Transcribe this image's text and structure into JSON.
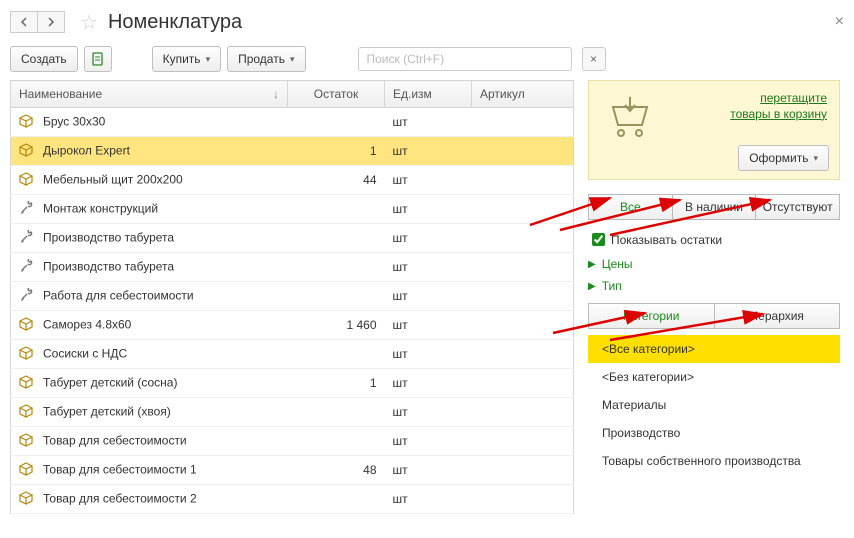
{
  "header": {
    "title": "Номенклатура"
  },
  "toolbar": {
    "create": "Создать",
    "buy": "Купить",
    "sell": "Продать",
    "search_placeholder": "Поиск (Ctrl+F)"
  },
  "table": {
    "columns": {
      "name": "Наименование",
      "stock": "Остаток",
      "unit": "Ед.изм",
      "sku": "Артикул"
    },
    "rows": [
      {
        "icon": "box",
        "name": "Брус 30х30",
        "stock": "",
        "unit": "шт",
        "sku": ""
      },
      {
        "icon": "box",
        "name": "Дырокол Expert",
        "stock": "1",
        "unit": "шт",
        "sku": "",
        "selected": true
      },
      {
        "icon": "box",
        "name": "Мебельный щит 200х200",
        "stock": "44",
        "unit": "шт",
        "sku": ""
      },
      {
        "icon": "tool",
        "name": "Монтаж конструкций",
        "stock": "",
        "unit": "шт",
        "sku": ""
      },
      {
        "icon": "tool",
        "name": "Производство табурета",
        "stock": "",
        "unit": "шт",
        "sku": ""
      },
      {
        "icon": "tool",
        "name": "Производство табурета",
        "stock": "",
        "unit": "шт",
        "sku": ""
      },
      {
        "icon": "tool",
        "name": "Работа для себестоимости",
        "stock": "",
        "unit": "шт",
        "sku": ""
      },
      {
        "icon": "box",
        "name": "Саморез 4.8х60",
        "stock": "1 460",
        "unit": "шт",
        "sku": ""
      },
      {
        "icon": "box",
        "name": "Сосиски с НДС",
        "stock": "",
        "unit": "шт",
        "sku": ""
      },
      {
        "icon": "box",
        "name": "Табурет детский (сосна)",
        "stock": "1",
        "unit": "шт",
        "sku": ""
      },
      {
        "icon": "box",
        "name": "Табурет детский (хвоя)",
        "stock": "",
        "unit": "шт",
        "sku": ""
      },
      {
        "icon": "box",
        "name": "Товар для себестоимости",
        "stock": "",
        "unit": "шт",
        "sku": ""
      },
      {
        "icon": "box",
        "name": "Товар для себестоимости 1",
        "stock": "48",
        "unit": "шт",
        "sku": ""
      },
      {
        "icon": "box",
        "name": "Товар для себестоимости 2",
        "stock": "",
        "unit": "шт",
        "sku": ""
      }
    ]
  },
  "cart": {
    "link_line1": "перетащите",
    "link_line2": "товары в корзину",
    "issue": "Оформить"
  },
  "filters": {
    "all": "Все",
    "in_stock": "В наличии",
    "out_stock": "Отсутствуют",
    "show_stock": "Показывать остатки",
    "prices": "Цены",
    "type": "Тип",
    "categories": "Категории",
    "hierarchy": "Иерархия"
  },
  "categories": [
    "<Все категории>",
    "<Без категории>",
    "Материалы",
    "Производство",
    "Товары собственного производства"
  ]
}
